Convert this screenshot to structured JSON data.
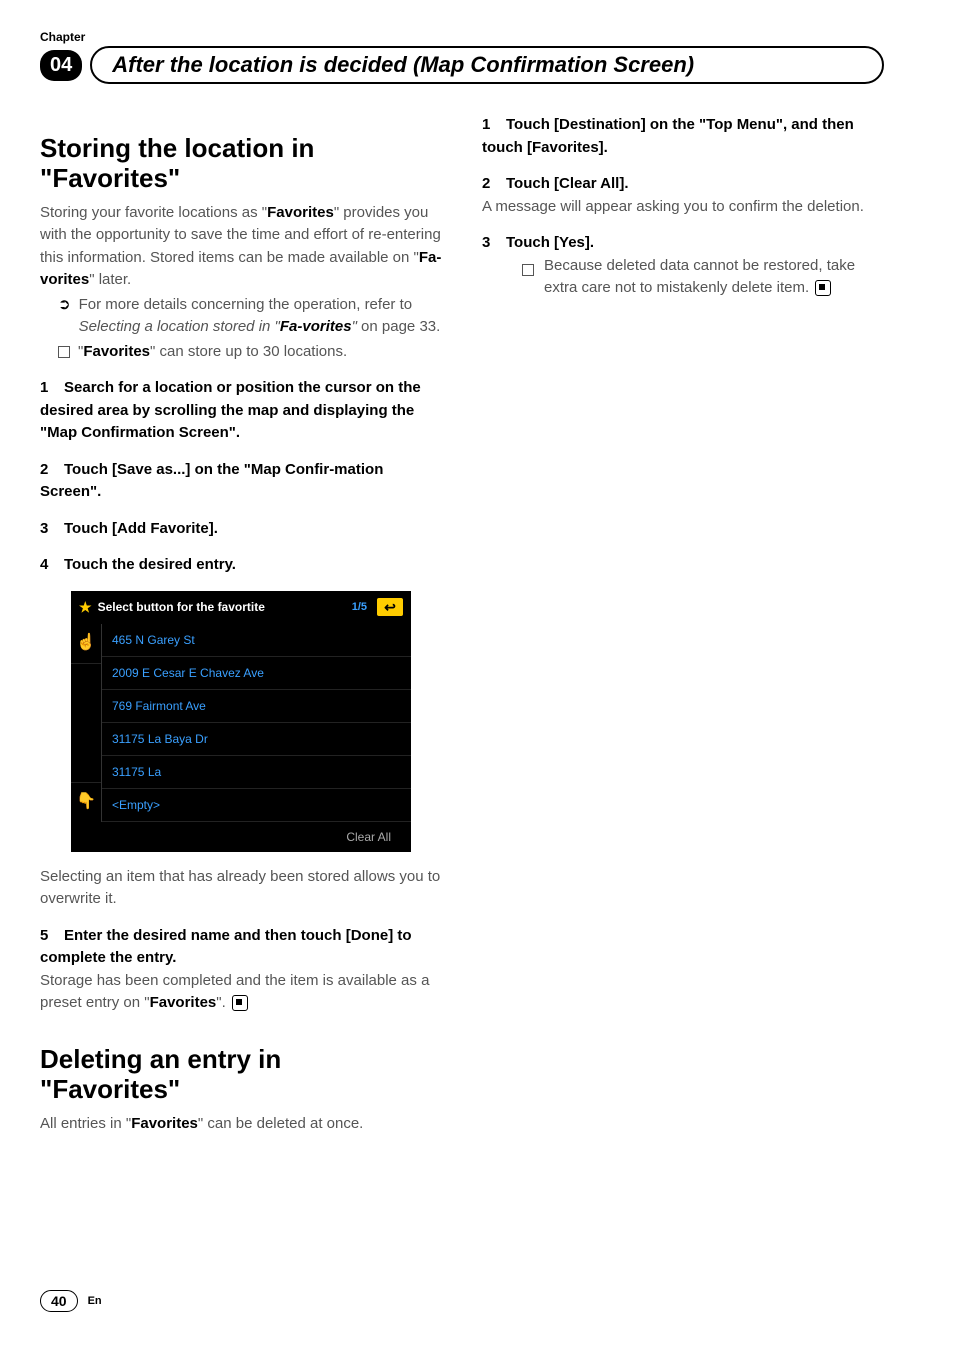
{
  "chapter_label": "Chapter",
  "chapter_number": "04",
  "header_title": "After the location is decided (Map Confirmation Screen)",
  "left": {
    "section1_title_a": "Storing the location in",
    "section1_title_b": "\"Favorites\"",
    "intro_a": "Storing your favorite locations as \"",
    "intro_b": "Favorites",
    "intro_c": "\" provides you with the opportunity to save the time and effort of re-entering this information. Stored items can be made available on \"",
    "intro_d": "Fa-vorites",
    "intro_e": "\" later.",
    "bullet1_a": "For more details concerning the operation, refer to ",
    "bullet1_b": "Selecting a location stored in \"",
    "bullet1_c": "Fa-vorites",
    "bullet1_d": "\"",
    "bullet1_e": " on page 33.",
    "bullet2_a": "\"",
    "bullet2_b": "Favorites",
    "bullet2_c": "\" can store up to 30 locations.",
    "step1": "Search for a location or position the cursor on the desired area by scrolling the map and displaying the \"Map Confirmation Screen\".",
    "step2": "Touch [Save as...] on the \"Map Confir-mation Screen\".",
    "step3": "Touch [Add Favorite].",
    "step4": "Touch the desired entry.",
    "after_ss": "Selecting an item that has already been stored allows you to overwrite it.",
    "step5_a": "Enter the desired name and then touch [Done] to complete the entry.",
    "step5_b": "Storage has been completed and the item is available as a preset entry on \"",
    "step5_c": "Favorites",
    "step5_d": "\".",
    "section2_title_a": "Deleting an entry in",
    "section2_title_b": "\"Favorites\"",
    "del_intro_a": "All entries in \"",
    "del_intro_b": "Favorites",
    "del_intro_c": "\" can be deleted at once."
  },
  "right": {
    "step1": "Touch [Destination] on the \"Top Menu\", and then touch [Favorites].",
    "step2": "Touch [Clear All].",
    "step2_body": "A message will appear asking you to confirm the deletion.",
    "step3": "Touch [Yes].",
    "step3_sub": "Because deleted data cannot be restored, take extra care not to mistakenly delete item."
  },
  "screenshot": {
    "title": "Select button for the favortite",
    "page": "1/5",
    "rows": [
      "465 N Garey St",
      "2009 E Cesar E Chavez Ave",
      "769 Fairmont Ave",
      "31175 La Baya Dr",
      "31175 La",
      "<Empty>"
    ],
    "clear": "Clear All"
  },
  "footer": {
    "page": "40",
    "lang": "En"
  }
}
